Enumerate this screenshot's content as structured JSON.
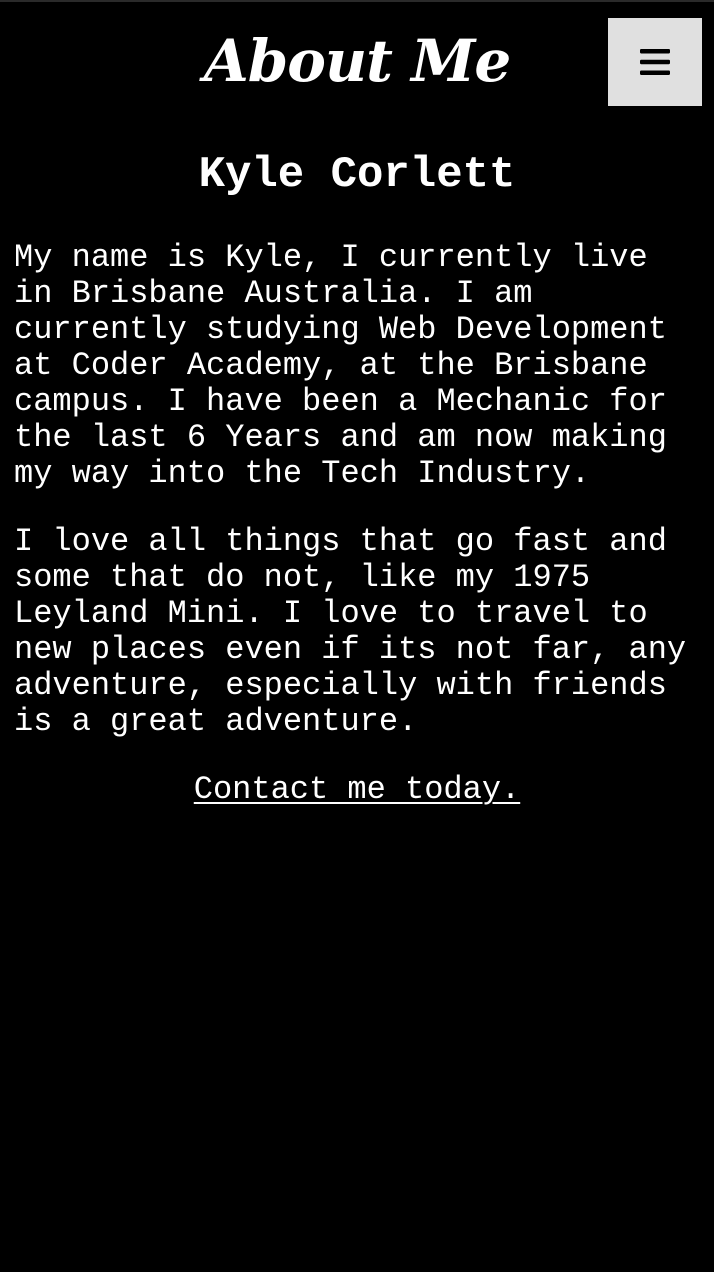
{
  "header": {
    "title": "About Me",
    "menu_icon": "hamburger-menu-icon"
  },
  "profile": {
    "name": "Kyle Corlett"
  },
  "bio": {
    "paragraph_1": "My name is Kyle, I currently live\nin Brisbane Australia. I am\ncurrently studying Web Development\nat Coder Academy, at the Brisbane\ncampus. I have been a Mechanic for\nthe last 6 Years and am now making\nmy way into the Tech Industry.",
    "paragraph_2": "I love all things that go fast and\nsome that do not, like my 1975\nLeyland Mini. I love to travel to\nnew places even if its not far, any\nadventure, especially with friends\nis a great adventure."
  },
  "contact": {
    "link_text": "Contact me today."
  },
  "colors": {
    "background": "#000000",
    "text": "#ffffff",
    "menu_button": "#e0e0e0",
    "menu_icon": "#000000"
  }
}
